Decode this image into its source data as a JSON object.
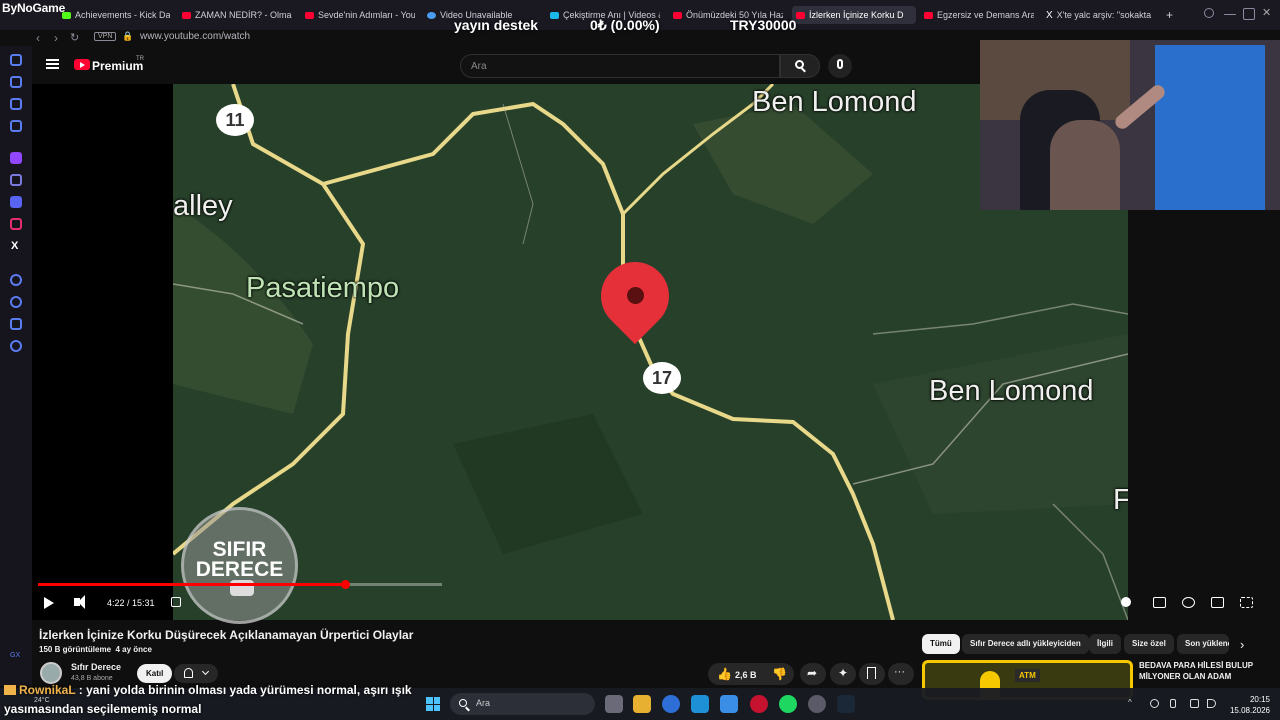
{
  "browser": {
    "brand": "ByNoGame",
    "tabs": [
      {
        "label": "Achievements - Kick Das",
        "icon": "kick-icon"
      },
      {
        "label": "ZAMAN NEDİR? - Olmaz",
        "icon": "youtube-icon"
      },
      {
        "label": "Sevde'nin Adımları - YouT",
        "icon": "youtube-icon"
      },
      {
        "label": "Video Unavailable",
        "icon": "globe-icon"
      },
      {
        "label": "Çekiştirme Anı | Videos &",
        "icon": "vimeo-icon"
      },
      {
        "label": "Önümüzdeki 50 Yıla Hazı",
        "icon": "youtube-icon"
      },
      {
        "label": "İzlerken İçinize Korku D",
        "icon": "youtube-icon",
        "active": true
      },
      {
        "label": "Egzersiz ve Demans Aras",
        "icon": "youtube-icon"
      },
      {
        "label": "X'te yalc arşiv: \"sokakta",
        "icon": "x-icon"
      }
    ],
    "vpn": "VPN",
    "url": "www.youtube.com/watch"
  },
  "stream_overlay": {
    "left_text": "yayın destek",
    "center_text": "0₺ (0.00%)",
    "right_text": "TRY30000"
  },
  "youtube": {
    "logo_text": "Premium",
    "logo_region": "TR",
    "search_placeholder": "Ara"
  },
  "map": {
    "labels": {
      "valley": "alley",
      "pasatiempo": "Pasatiempo",
      "ben_lomond_top": "Ben Lomond",
      "ben_lomond_right": "Ben Lomond",
      "edge": "F"
    },
    "road_badges": [
      "11",
      "17"
    ],
    "watermark_line1": "SIFIR",
    "watermark_line2": "DERECE"
  },
  "player": {
    "time": "4:22 / 15:31",
    "progress": 0.2815
  },
  "video": {
    "title": "İzlerken İçinize Korku Düşürecek Açıklanamayan Ürpertici Olaylar",
    "views": "150 B görüntüleme",
    "age": "4 ay önce",
    "channel": "Sıfır Derece",
    "subscribers": "43,8 B abone",
    "join_label": "Katıl",
    "likes": "2,6 B"
  },
  "chips": [
    "Tümü",
    "Sıfır Derece adlı yükleyiciden",
    "İlgili",
    "Size özel",
    "Son yüklenen"
  ],
  "recommendation": {
    "title_line1": "BEDAVA PARA HİLESİ BULUP",
    "title_line2": "MİLYONER OLAN ADAM",
    "thumb_text": "ATM"
  },
  "chat": {
    "user": "RownikaL",
    "message": " : yani yolda birinin olması yada yürümesi normal, aşırı ışık yasımasından seçilememiş normal"
  },
  "taskbar": {
    "weather": "24°C",
    "search": "Ara",
    "time": "20:15",
    "date": "15.08.2026"
  },
  "colors": {
    "yt_red": "#ff0033",
    "accent_gold": "#f5c800",
    "map_green": "#29402a"
  }
}
